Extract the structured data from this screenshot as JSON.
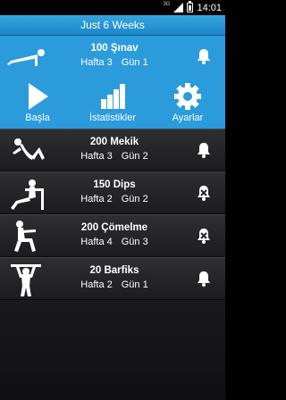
{
  "status": {
    "network": "3G",
    "time": "14:01"
  },
  "app": {
    "title": "Just 6 Weeks"
  },
  "hero": {
    "title": "100 Şınav",
    "week": "Hafta 3",
    "day": "Gün 1"
  },
  "actions": [
    {
      "label": "Başla",
      "icon": "play-icon"
    },
    {
      "label": "İstatistikler",
      "icon": "bar-chart-icon"
    },
    {
      "label": "Ayarlar",
      "icon": "gear-icon"
    }
  ],
  "exercises": [
    {
      "title": "200 Mekik",
      "week": "Hafta 3",
      "day": "Gün 2",
      "icon": "situp-figure-icon",
      "bell": "bell-icon"
    },
    {
      "title": "150 Dips",
      "week": "Hafta 2",
      "day": "Gün 2",
      "icon": "dips-figure-icon",
      "bell": "bell-off-icon"
    },
    {
      "title": "200 Çömelme",
      "week": "Hafta 4",
      "day": "Gün 3",
      "icon": "squat-figure-icon",
      "bell": "bell-off-icon"
    },
    {
      "title": "20 Barfiks",
      "week": "Hafta 2",
      "day": "Gün 1",
      "icon": "pullup-figure-icon",
      "bell": "bell-icon"
    }
  ],
  "colors": {
    "accent": "#2b9bdc",
    "titlebar": "#1d87c9",
    "row": "#242426"
  }
}
